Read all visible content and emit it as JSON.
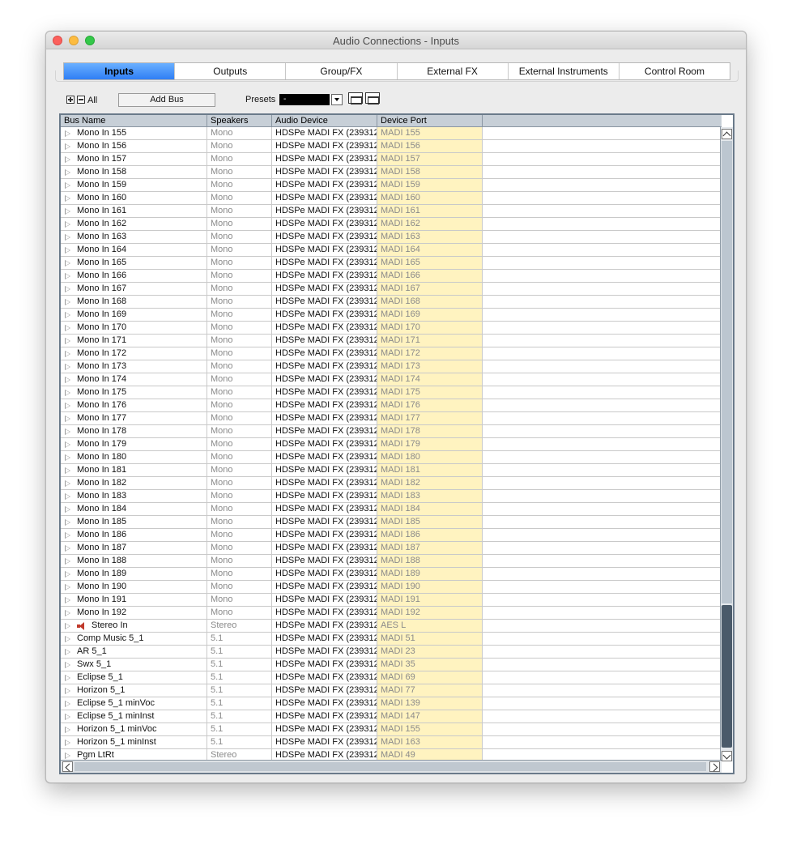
{
  "window": {
    "title": "Audio Connections - Inputs"
  },
  "tabs": [
    {
      "label": "Inputs",
      "active": true
    },
    {
      "label": "Outputs",
      "active": false
    },
    {
      "label": "Group/FX",
      "active": false
    },
    {
      "label": "External FX",
      "active": false
    },
    {
      "label": "External Instruments",
      "active": false
    },
    {
      "label": "Control Room",
      "active": false
    }
  ],
  "toolbar": {
    "all_label": "All",
    "add_bus_label": "Add Bus",
    "presets_label": "Presets",
    "presets_value": "-"
  },
  "table": {
    "columns": [
      "Bus Name",
      "Speakers",
      "Audio Device",
      "Device Port"
    ],
    "rows": [
      {
        "name": "Mono In 155",
        "speakers": "Mono",
        "device": "HDSPe MADI FX (239312",
        "port": "MADI 155",
        "icon": ""
      },
      {
        "name": "Mono In 156",
        "speakers": "Mono",
        "device": "HDSPe MADI FX (239312",
        "port": "MADI 156",
        "icon": ""
      },
      {
        "name": "Mono In 157",
        "speakers": "Mono",
        "device": "HDSPe MADI FX (239312",
        "port": "MADI 157",
        "icon": ""
      },
      {
        "name": "Mono In 158",
        "speakers": "Mono",
        "device": "HDSPe MADI FX (239312",
        "port": "MADI 158",
        "icon": ""
      },
      {
        "name": "Mono In 159",
        "speakers": "Mono",
        "device": "HDSPe MADI FX (239312",
        "port": "MADI 159",
        "icon": ""
      },
      {
        "name": "Mono In 160",
        "speakers": "Mono",
        "device": "HDSPe MADI FX (239312",
        "port": "MADI 160",
        "icon": ""
      },
      {
        "name": "Mono In 161",
        "speakers": "Mono",
        "device": "HDSPe MADI FX (239312",
        "port": "MADI 161",
        "icon": ""
      },
      {
        "name": "Mono In 162",
        "speakers": "Mono",
        "device": "HDSPe MADI FX (239312",
        "port": "MADI 162",
        "icon": ""
      },
      {
        "name": "Mono In 163",
        "speakers": "Mono",
        "device": "HDSPe MADI FX (239312",
        "port": "MADI 163",
        "icon": ""
      },
      {
        "name": "Mono In 164",
        "speakers": "Mono",
        "device": "HDSPe MADI FX (239312",
        "port": "MADI 164",
        "icon": ""
      },
      {
        "name": "Mono In 165",
        "speakers": "Mono",
        "device": "HDSPe MADI FX (239312",
        "port": "MADI 165",
        "icon": ""
      },
      {
        "name": "Mono In 166",
        "speakers": "Mono",
        "device": "HDSPe MADI FX (239312",
        "port": "MADI 166",
        "icon": ""
      },
      {
        "name": "Mono In 167",
        "speakers": "Mono",
        "device": "HDSPe MADI FX (239312",
        "port": "MADI 167",
        "icon": ""
      },
      {
        "name": "Mono In 168",
        "speakers": "Mono",
        "device": "HDSPe MADI FX (239312",
        "port": "MADI 168",
        "icon": ""
      },
      {
        "name": "Mono In 169",
        "speakers": "Mono",
        "device": "HDSPe MADI FX (239312",
        "port": "MADI 169",
        "icon": ""
      },
      {
        "name": "Mono In 170",
        "speakers": "Mono",
        "device": "HDSPe MADI FX (239312",
        "port": "MADI 170",
        "icon": ""
      },
      {
        "name": "Mono In 171",
        "speakers": "Mono",
        "device": "HDSPe MADI FX (239312",
        "port": "MADI 171",
        "icon": ""
      },
      {
        "name": "Mono In 172",
        "speakers": "Mono",
        "device": "HDSPe MADI FX (239312",
        "port": "MADI 172",
        "icon": ""
      },
      {
        "name": "Mono In 173",
        "speakers": "Mono",
        "device": "HDSPe MADI FX (239312",
        "port": "MADI 173",
        "icon": ""
      },
      {
        "name": "Mono In 174",
        "speakers": "Mono",
        "device": "HDSPe MADI FX (239312",
        "port": "MADI 174",
        "icon": ""
      },
      {
        "name": "Mono In 175",
        "speakers": "Mono",
        "device": "HDSPe MADI FX (239312",
        "port": "MADI 175",
        "icon": ""
      },
      {
        "name": "Mono In 176",
        "speakers": "Mono",
        "device": "HDSPe MADI FX (239312",
        "port": "MADI 176",
        "icon": ""
      },
      {
        "name": "Mono In 177",
        "speakers": "Mono",
        "device": "HDSPe MADI FX (239312",
        "port": "MADI 177",
        "icon": ""
      },
      {
        "name": "Mono In 178",
        "speakers": "Mono",
        "device": "HDSPe MADI FX (239312",
        "port": "MADI 178",
        "icon": ""
      },
      {
        "name": "Mono In 179",
        "speakers": "Mono",
        "device": "HDSPe MADI FX (239312",
        "port": "MADI 179",
        "icon": ""
      },
      {
        "name": "Mono In 180",
        "speakers": "Mono",
        "device": "HDSPe MADI FX (239312",
        "port": "MADI 180",
        "icon": ""
      },
      {
        "name": "Mono In 181",
        "speakers": "Mono",
        "device": "HDSPe MADI FX (239312",
        "port": "MADI 181",
        "icon": ""
      },
      {
        "name": "Mono In 182",
        "speakers": "Mono",
        "device": "HDSPe MADI FX (239312",
        "port": "MADI 182",
        "icon": ""
      },
      {
        "name": "Mono In 183",
        "speakers": "Mono",
        "device": "HDSPe MADI FX (239312",
        "port": "MADI 183",
        "icon": ""
      },
      {
        "name": "Mono In 184",
        "speakers": "Mono",
        "device": "HDSPe MADI FX (239312",
        "port": "MADI 184",
        "icon": ""
      },
      {
        "name": "Mono In 185",
        "speakers": "Mono",
        "device": "HDSPe MADI FX (239312",
        "port": "MADI 185",
        "icon": ""
      },
      {
        "name": "Mono In 186",
        "speakers": "Mono",
        "device": "HDSPe MADI FX (239312",
        "port": "MADI 186",
        "icon": ""
      },
      {
        "name": "Mono In 187",
        "speakers": "Mono",
        "device": "HDSPe MADI FX (239312",
        "port": "MADI 187",
        "icon": ""
      },
      {
        "name": "Mono In 188",
        "speakers": "Mono",
        "device": "HDSPe MADI FX (239312",
        "port": "MADI 188",
        "icon": ""
      },
      {
        "name": "Mono In 189",
        "speakers": "Mono",
        "device": "HDSPe MADI FX (239312",
        "port": "MADI 189",
        "icon": ""
      },
      {
        "name": "Mono In 190",
        "speakers": "Mono",
        "device": "HDSPe MADI FX (239312",
        "port": "MADI 190",
        "icon": ""
      },
      {
        "name": "Mono In 191",
        "speakers": "Mono",
        "device": "HDSPe MADI FX (239312",
        "port": "MADI 191",
        "icon": ""
      },
      {
        "name": "Mono In 192",
        "speakers": "Mono",
        "device": "HDSPe MADI FX (239312",
        "port": "MADI 192",
        "icon": ""
      },
      {
        "name": "Stereo In",
        "speakers": "Stereo",
        "device": "HDSPe MADI FX (239312",
        "port": "AES L",
        "icon": "speaker-icon"
      },
      {
        "name": "Comp Music 5_1",
        "speakers": "5.1",
        "device": "HDSPe MADI FX (239312",
        "port": "MADI 51",
        "icon": ""
      },
      {
        "name": "AR 5_1",
        "speakers": "5.1",
        "device": "HDSPe MADI FX (239312",
        "port": "MADI 23",
        "icon": ""
      },
      {
        "name": "Swx 5_1",
        "speakers": "5.1",
        "device": "HDSPe MADI FX (239312",
        "port": "MADI 35",
        "icon": ""
      },
      {
        "name": "Eclipse 5_1",
        "speakers": "5.1",
        "device": "HDSPe MADI FX (239312",
        "port": "MADI 69",
        "icon": ""
      },
      {
        "name": "Horizon 5_1",
        "speakers": "5.1",
        "device": "HDSPe MADI FX (239312",
        "port": "MADI 77",
        "icon": ""
      },
      {
        "name": "Eclipse 5_1 minVoc",
        "speakers": "5.1",
        "device": "HDSPe MADI FX (239312",
        "port": "MADI 139",
        "icon": ""
      },
      {
        "name": "Eclipse 5_1 minInst",
        "speakers": "5.1",
        "device": "HDSPe MADI FX (239312",
        "port": "MADI 147",
        "icon": ""
      },
      {
        "name": "Horizon 5_1 minVoc",
        "speakers": "5.1",
        "device": "HDSPe MADI FX (239312",
        "port": "MADI 155",
        "icon": ""
      },
      {
        "name": "Horizon 5_1 minInst",
        "speakers": "5.1",
        "device": "HDSPe MADI FX (239312",
        "port": "MADI 163",
        "icon": ""
      },
      {
        "name": "Pgm LtRt",
        "speakers": "Stereo",
        "device": "HDSPe MADI FX (239312",
        "port": "MADI 49",
        "icon": ""
      }
    ]
  }
}
